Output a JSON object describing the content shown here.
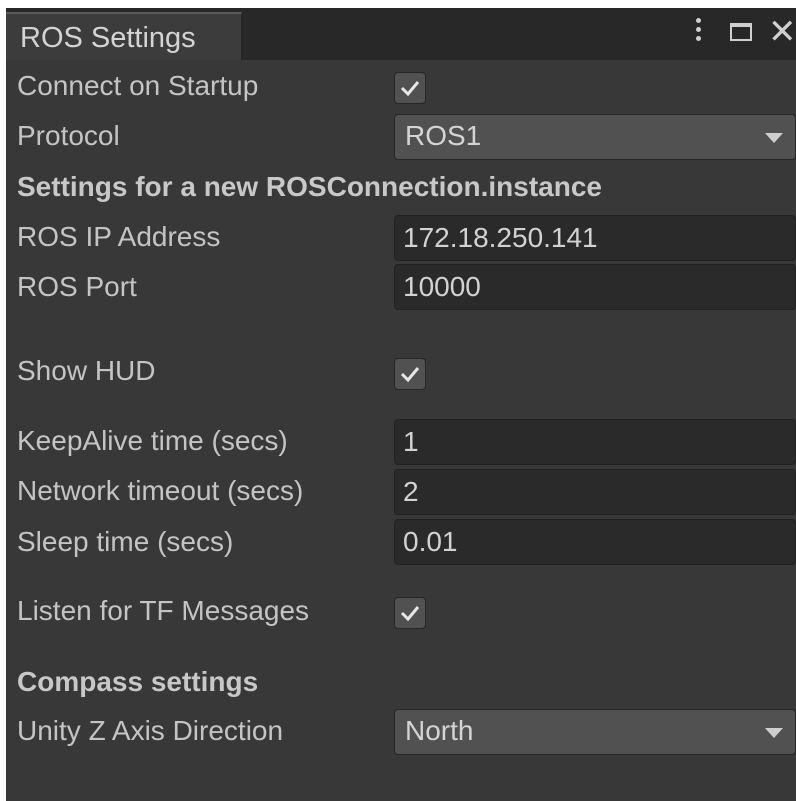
{
  "window": {
    "tab_title": "ROS Settings",
    "icons": [
      "kebab-menu-icon",
      "maximize-icon",
      "close-icon"
    ]
  },
  "settings": {
    "connect_on_startup": {
      "label": "Connect on Startup",
      "checked": true
    },
    "protocol": {
      "label": "Protocol",
      "value": "ROS1"
    },
    "section_new_connection": "Settings for a new ROSConnection.instance",
    "ros_ip": {
      "label": "ROS IP Address",
      "value": "172.18.250.141"
    },
    "ros_port": {
      "label": "ROS Port",
      "value": "10000"
    },
    "show_hud": {
      "label": "Show HUD",
      "checked": true
    },
    "keepalive": {
      "label": "KeepAlive time (secs)",
      "value": "1"
    },
    "network_timeout": {
      "label": "Network timeout (secs)",
      "value": "2"
    },
    "sleep_time": {
      "label": "Sleep time (secs)",
      "value": "0.01"
    },
    "listen_tf": {
      "label": "Listen for TF Messages",
      "checked": true
    },
    "section_compass": "Compass settings",
    "unity_z_axis": {
      "label": "Unity Z Axis Direction",
      "value": "North"
    }
  },
  "colors": {
    "panel_bg": "#383838",
    "field_bg": "#2a2a2a",
    "control_bg": "#515151",
    "text": "#c4c4c4"
  }
}
